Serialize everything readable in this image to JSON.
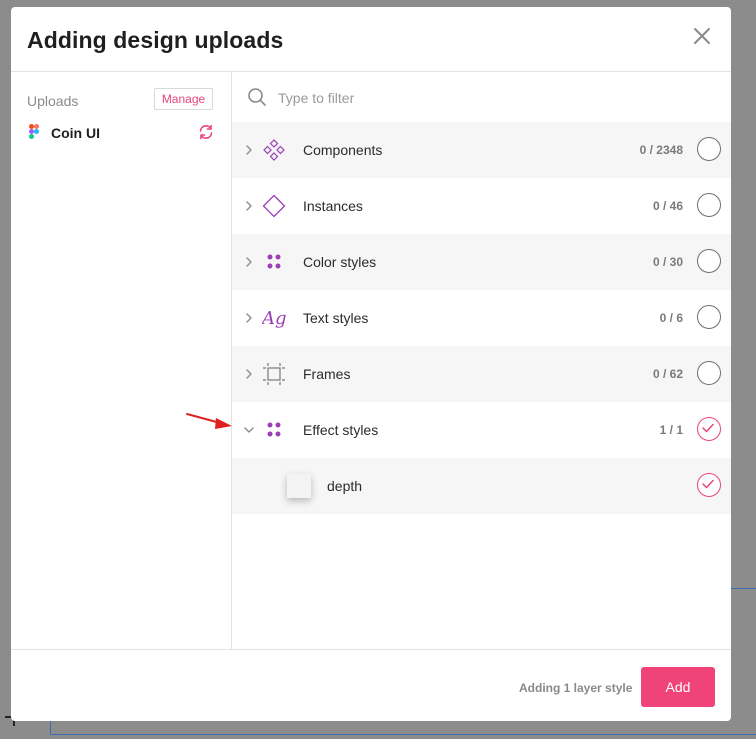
{
  "modal": {
    "title": "Adding design uploads"
  },
  "sidebar": {
    "uploads_label": "Uploads",
    "manage_label": "Manage",
    "upload": {
      "name": "Coin UI",
      "icon": "figma-icon",
      "action_icon": "sync-icon"
    }
  },
  "filter": {
    "placeholder": "Type to filter",
    "value": "",
    "icon": "search-icon"
  },
  "categories": [
    {
      "label": "Components",
      "count": "0 / 2348",
      "icon": "components-icon",
      "checked": false,
      "expanded": false
    },
    {
      "label": "Instances",
      "count": "0 / 46",
      "icon": "instance-icon",
      "checked": false,
      "expanded": false
    },
    {
      "label": "Color styles",
      "count": "0 / 30",
      "icon": "color-styles-icon",
      "checked": false,
      "expanded": false
    },
    {
      "label": "Text styles",
      "count": "0 / 6",
      "icon": "text-styles-icon",
      "checked": false,
      "expanded": false
    },
    {
      "label": "Frames",
      "count": "0 / 62",
      "icon": "frame-icon",
      "checked": false,
      "expanded": false
    },
    {
      "label": "Effect styles",
      "count": "1 / 1",
      "icon": "effect-styles-icon",
      "checked": true,
      "expanded": true,
      "children": [
        {
          "label": "depth",
          "checked": true
        }
      ]
    }
  ],
  "footer": {
    "status": "Adding 1 layer style",
    "add_label": "Add"
  },
  "colors": {
    "accent": "#f0437a",
    "icon_purple": "#9b3fb5",
    "row_alt": "#f6f6f6"
  }
}
